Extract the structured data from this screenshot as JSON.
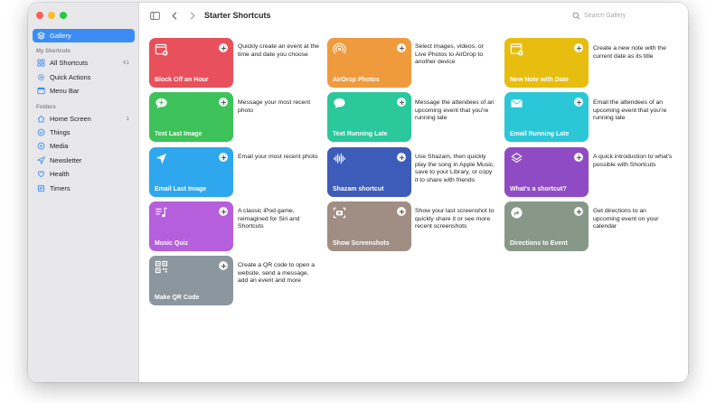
{
  "window": {
    "title": "Starter Shortcuts"
  },
  "sidebar": {
    "gallery": "Gallery",
    "section_my": "My Shortcuts",
    "all_shortcuts": "All Shortcuts",
    "all_shortcuts_count": "41",
    "quick_actions": "Quick Actions",
    "menu_bar": "Menu Bar",
    "section_folders": "Folders",
    "home_screen": "Home Screen",
    "home_screen_count": "1",
    "things": "Things",
    "media": "Media",
    "newsletter": "Newsletter",
    "health": "Health",
    "timers": "Timers"
  },
  "search": {
    "placeholder": "Search Gallery"
  },
  "shortcuts": [
    {
      "name": "Block Off an Hour",
      "desc": "Quickly create an event at the time and date you choose",
      "color": "#e8505b",
      "icon": "calendar-plus-icon"
    },
    {
      "name": "AirDrop Photos",
      "desc": "Select images, videos, or Live Photos to AirDrop to another device",
      "color": "#f09a3e",
      "icon": "airdrop-icon"
    },
    {
      "name": "New Note with Date",
      "desc": "Create a new note with the current date as its title",
      "color": "#e7bd10",
      "icon": "note-plus-icon"
    },
    {
      "name": "Text Last Image",
      "desc": "Message your most recent photo",
      "color": "#3ec25a",
      "icon": "message-plus-icon"
    },
    {
      "name": "Text Running Late",
      "desc": "Message the attendees of an upcoming event that you're running late",
      "color": "#2bc89b",
      "icon": "message-icon"
    },
    {
      "name": "Email Running Late",
      "desc": "Email the attendees of an upcoming event that you're running late",
      "color": "#2bc7d6",
      "icon": "envelope-icon"
    },
    {
      "name": "Email Last Image",
      "desc": "Email your most recent photo",
      "color": "#2ea7ee",
      "icon": "location-arrow-icon"
    },
    {
      "name": "Shazam shortcut",
      "desc": "Use Shazam, then quickly play the song in Apple Music, save to your Library, or copy it to share with friends",
      "color": "#3d5bb8",
      "icon": "waveform-icon"
    },
    {
      "name": "What's a shortcut?",
      "desc": "A quick introduction to what's possible with Shortcuts",
      "color": "#8f4bc4",
      "icon": "layers-icon"
    },
    {
      "name": "Music Quiz",
      "desc": "A classic iPod game, reimagined for Siri and Shortcuts",
      "color": "#b55fdc",
      "icon": "music-list-icon"
    },
    {
      "name": "Show Screenshots",
      "desc": "Show your last screenshot to quickly share it or see more recent screenshots",
      "color": "#a08d83",
      "icon": "camera-viewfinder-icon"
    },
    {
      "name": "Directions to Event",
      "desc": "Get directions to an upcoming event on your calendar",
      "color": "#879888",
      "icon": "directions-icon"
    },
    {
      "name": "Make QR Code",
      "desc": "Create a QR code to open a website, send a message, add an event and more",
      "color": "#8b969f",
      "icon": "qrcode-icon"
    }
  ]
}
